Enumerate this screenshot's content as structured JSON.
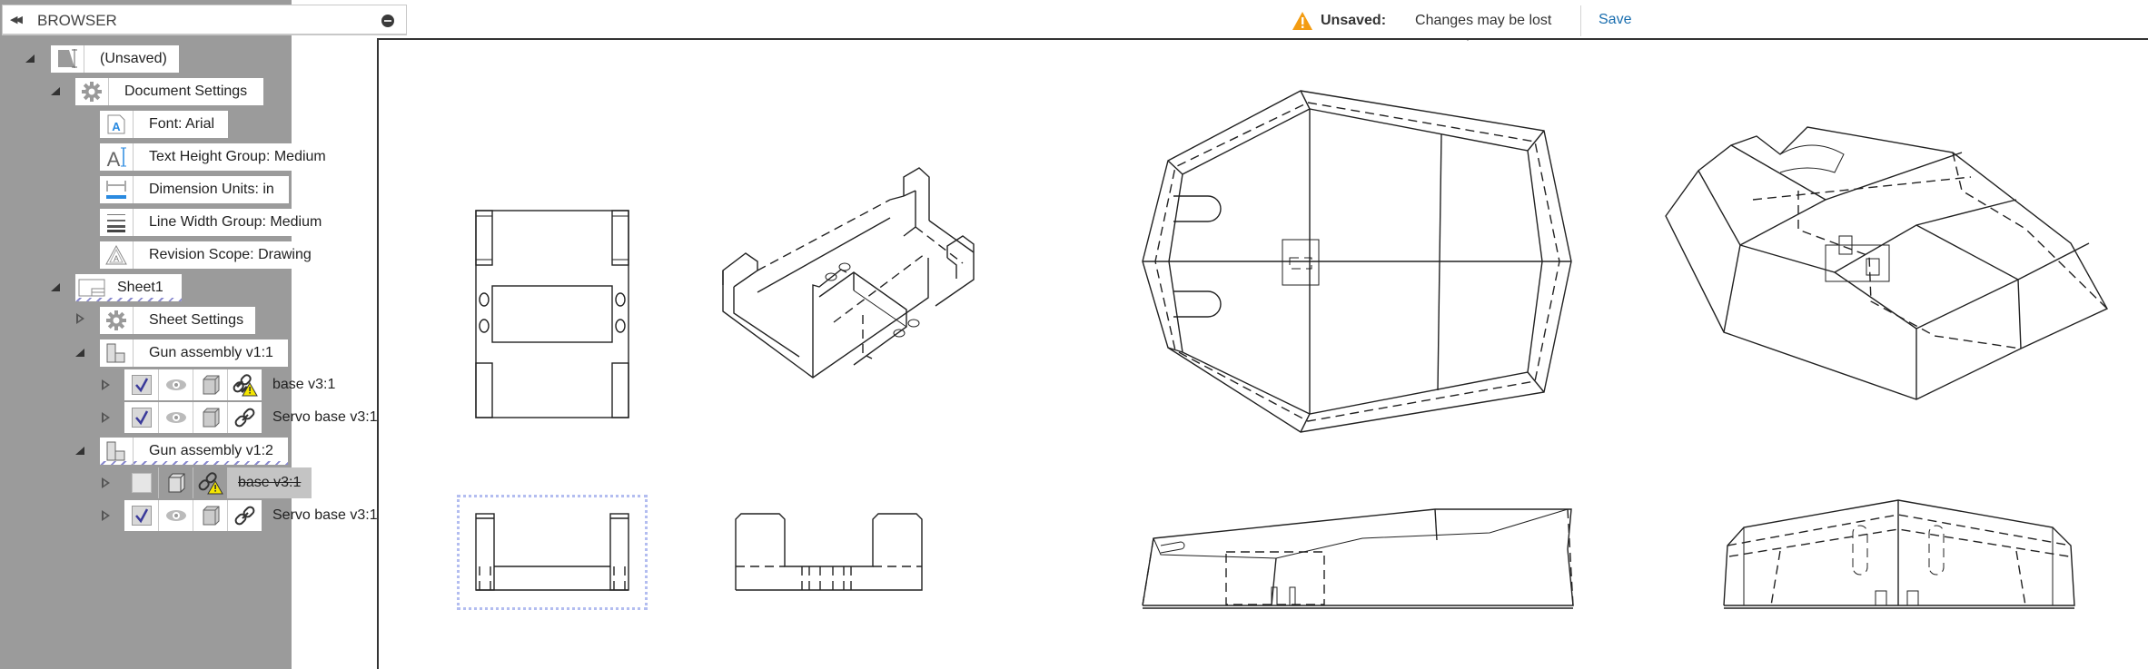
{
  "browser": {
    "title": "BROWSER",
    "collapse_icon": "double-left-arrow-icon",
    "minimize_icon": "minus-circle-icon"
  },
  "topbar": {
    "status_icon": "warning-triangle-icon",
    "status_label": "Unsaved:",
    "status_message": "Changes may be lost",
    "save_label": "Save",
    "warning_color": "#f39c12",
    "link_color": "#1a6eaf"
  },
  "tree": {
    "root": {
      "label": "(Unsaved)",
      "icon": "drawing-icon",
      "expanded": true
    },
    "document_settings": {
      "label": "Document Settings",
      "icon": "gear-icon",
      "expanded": true,
      "items": [
        {
          "label": "Font: Arial",
          "icon": "font-icon"
        },
        {
          "label": "Text Height Group: Medium",
          "icon": "text-height-icon"
        },
        {
          "label": "Dimension Units: in",
          "icon": "dimension-units-icon"
        },
        {
          "label": "Line Width Group: Medium",
          "icon": "line-width-icon"
        },
        {
          "label": "Revision Scope: Drawing",
          "icon": "revision-icon"
        }
      ]
    },
    "sheet": {
      "label": "Sheet1",
      "icon": "sheet-icon",
      "expanded": true,
      "sheet_settings": {
        "label": "Sheet Settings",
        "icon": "gear-icon",
        "expanded": false
      },
      "views": [
        {
          "label": "Gun assembly v1:1",
          "icon": "assembly-icon",
          "expanded": true,
          "components": [
            {
              "name": "base v3:1",
              "checked": true,
              "visible": true,
              "link_warning": true,
              "suppressed": false
            },
            {
              "name": "Servo base v3:1",
              "checked": true,
              "visible": true,
              "link_warning": false,
              "suppressed": false
            }
          ]
        },
        {
          "label": "Gun assembly v1:2",
          "icon": "assembly-icon",
          "expanded": true,
          "components": [
            {
              "name": "base v3:1",
              "checked": false,
              "visible": false,
              "link_warning": true,
              "suppressed": true
            },
            {
              "name": "Servo base v3:1",
              "checked": true,
              "visible": true,
              "link_warning": false,
              "suppressed": false
            }
          ]
        }
      ]
    }
  },
  "canvas": {
    "views": [
      {
        "name": "servo-base-top-view"
      },
      {
        "name": "servo-base-isometric-view"
      },
      {
        "name": "servo-base-front-view",
        "selected": true
      },
      {
        "name": "servo-base-side-view"
      },
      {
        "name": "gun-base-top-view"
      },
      {
        "name": "gun-base-isometric-view"
      },
      {
        "name": "gun-base-front-view"
      },
      {
        "name": "gun-base-side-view"
      }
    ]
  }
}
